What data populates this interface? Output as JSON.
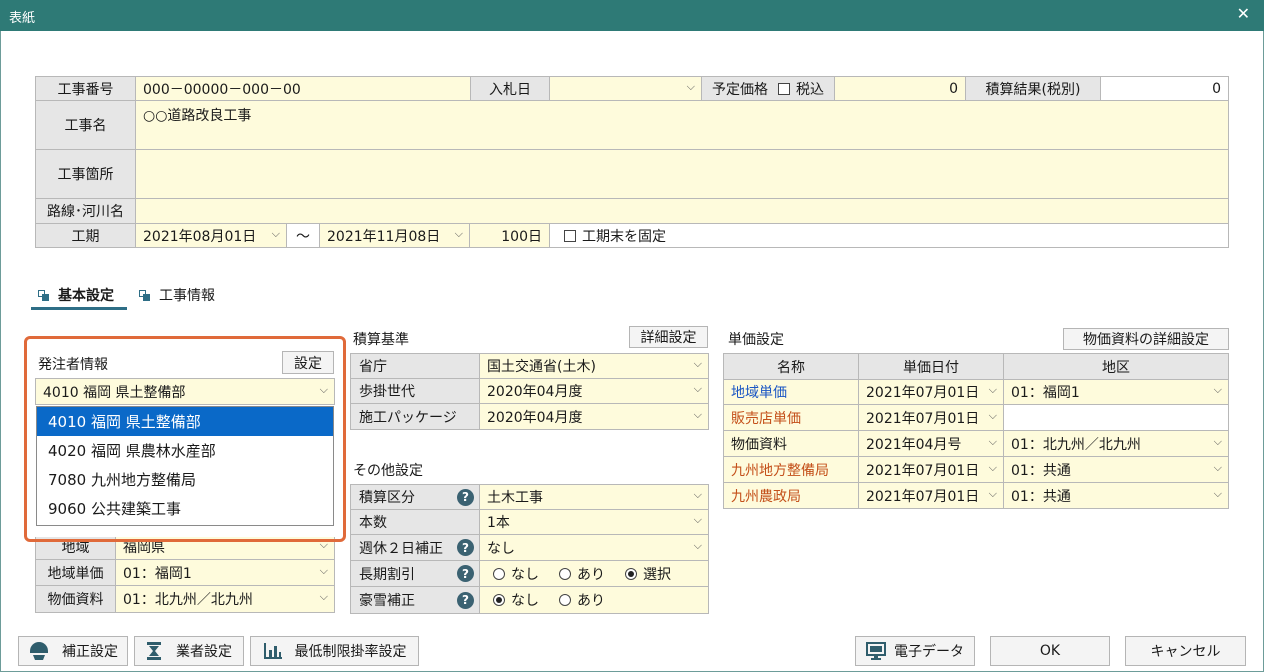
{
  "window": {
    "title": "表紙",
    "close_glyph": "✕"
  },
  "header": {
    "koji_bango_label": "工事番号",
    "koji_bango_value": "000－00000－000－00",
    "nyusatsu_label": "入札日",
    "nyusatsu_value": "",
    "yotei_label": "予定価格",
    "zeikomi_label": "税込",
    "yotei_value": "0",
    "sekisan_label": "積算結果(税別)",
    "sekisan_value": "0",
    "koji_mei_label": "工事名",
    "koji_mei_value": "○○道路改良工事",
    "koji_kasho_label": "工事箇所",
    "koji_kasho_value": "",
    "rosen_label": "路線･河川名",
    "rosen_value": "",
    "koki_label": "工期",
    "koki_start": "2021年08月01日",
    "koki_tilde": "～",
    "koki_end": "2021年11月08日",
    "koki_days": "100日",
    "koki_fix_label": "工期末を固定"
  },
  "tabs": [
    {
      "label": "基本設定"
    },
    {
      "label": "工事情報"
    }
  ],
  "hacchusha": {
    "title": "発注者情報",
    "settei_button": "設定",
    "selected": "4010 福岡 県土整備部",
    "options": [
      "4010 福岡 県土整備部",
      "4020 福岡 県農林水産部",
      "7080 九州地方整備局",
      "9060 公共建築工事"
    ],
    "chiiki_label": "地域",
    "chiiki_value": "福岡県",
    "chiiki_tanka_label": "地域単価",
    "chiiki_tanka_value": "01：福岡1",
    "bukka_label": "物価資料",
    "bukka_value": "01：北九州／北九州"
  },
  "sekisan_kijun": {
    "title": "積算基準",
    "detail_button": "詳細設定",
    "rows": [
      {
        "label": "省庁",
        "value": "国土交通省(土木)"
      },
      {
        "label": "歩掛世代",
        "value": "2020年04月度"
      },
      {
        "label": "施工パッケージ",
        "value": "2020年04月度"
      }
    ]
  },
  "sonota": {
    "title": "その他設定",
    "sekisan_kubun_label": "積算区分",
    "sekisan_kubun_value": "土木工事",
    "honsu_label": "本数",
    "honsu_value": "1本",
    "shukyu_label": "週休２日補正",
    "shukyu_value": "なし",
    "choki_label": "長期割引",
    "choki_options": [
      "なし",
      "あり",
      "選択"
    ],
    "gosetsu_label": "豪雪補正",
    "gosetsu_options": [
      "なし",
      "あり"
    ],
    "help_glyph": "?"
  },
  "tanka": {
    "title": "単価設定",
    "detail_button": "物価資料の詳細設定",
    "headers": [
      "名称",
      "単価日付",
      "地区"
    ],
    "rows": [
      {
        "name": "地域単価",
        "date": "2021年07月01日",
        "area": "01：福岡1",
        "color": "#1a56c4"
      },
      {
        "name": "販売店単価",
        "date": "2021年07月01日",
        "area": "",
        "color": "#c4501a"
      },
      {
        "name": "物価資料",
        "date": "2021年04月号",
        "area": "01：北九州／北九州",
        "color": "#1a1a1a"
      },
      {
        "name": "九州地方整備局",
        "date": "2021年07月01日",
        "area": "01：共通",
        "color": "#c4501a"
      },
      {
        "name": "九州農政局",
        "date": "2021年07月01日",
        "area": "01：共通",
        "color": "#c4501a"
      }
    ]
  },
  "footer": {
    "hosei_button": "補正設定",
    "gyosha_button": "業者設定",
    "saitei_button": "最低制限掛率設定",
    "denshi_button": "電子データ",
    "ok_button": "OK",
    "cancel_button": "キャンセル"
  },
  "colors": {
    "titlebar": "#2e7a76",
    "field_bg": "#fefbdc",
    "label_bg": "#e6e6e6",
    "highlight": "#e06a3a",
    "selected": "#0a69c8"
  },
  "icons": [
    "close-icon",
    "chevron-down-icon",
    "tab-icon",
    "help-icon",
    "hosei-icon",
    "gyosha-icon",
    "chart-icon",
    "monitor-icon"
  ]
}
